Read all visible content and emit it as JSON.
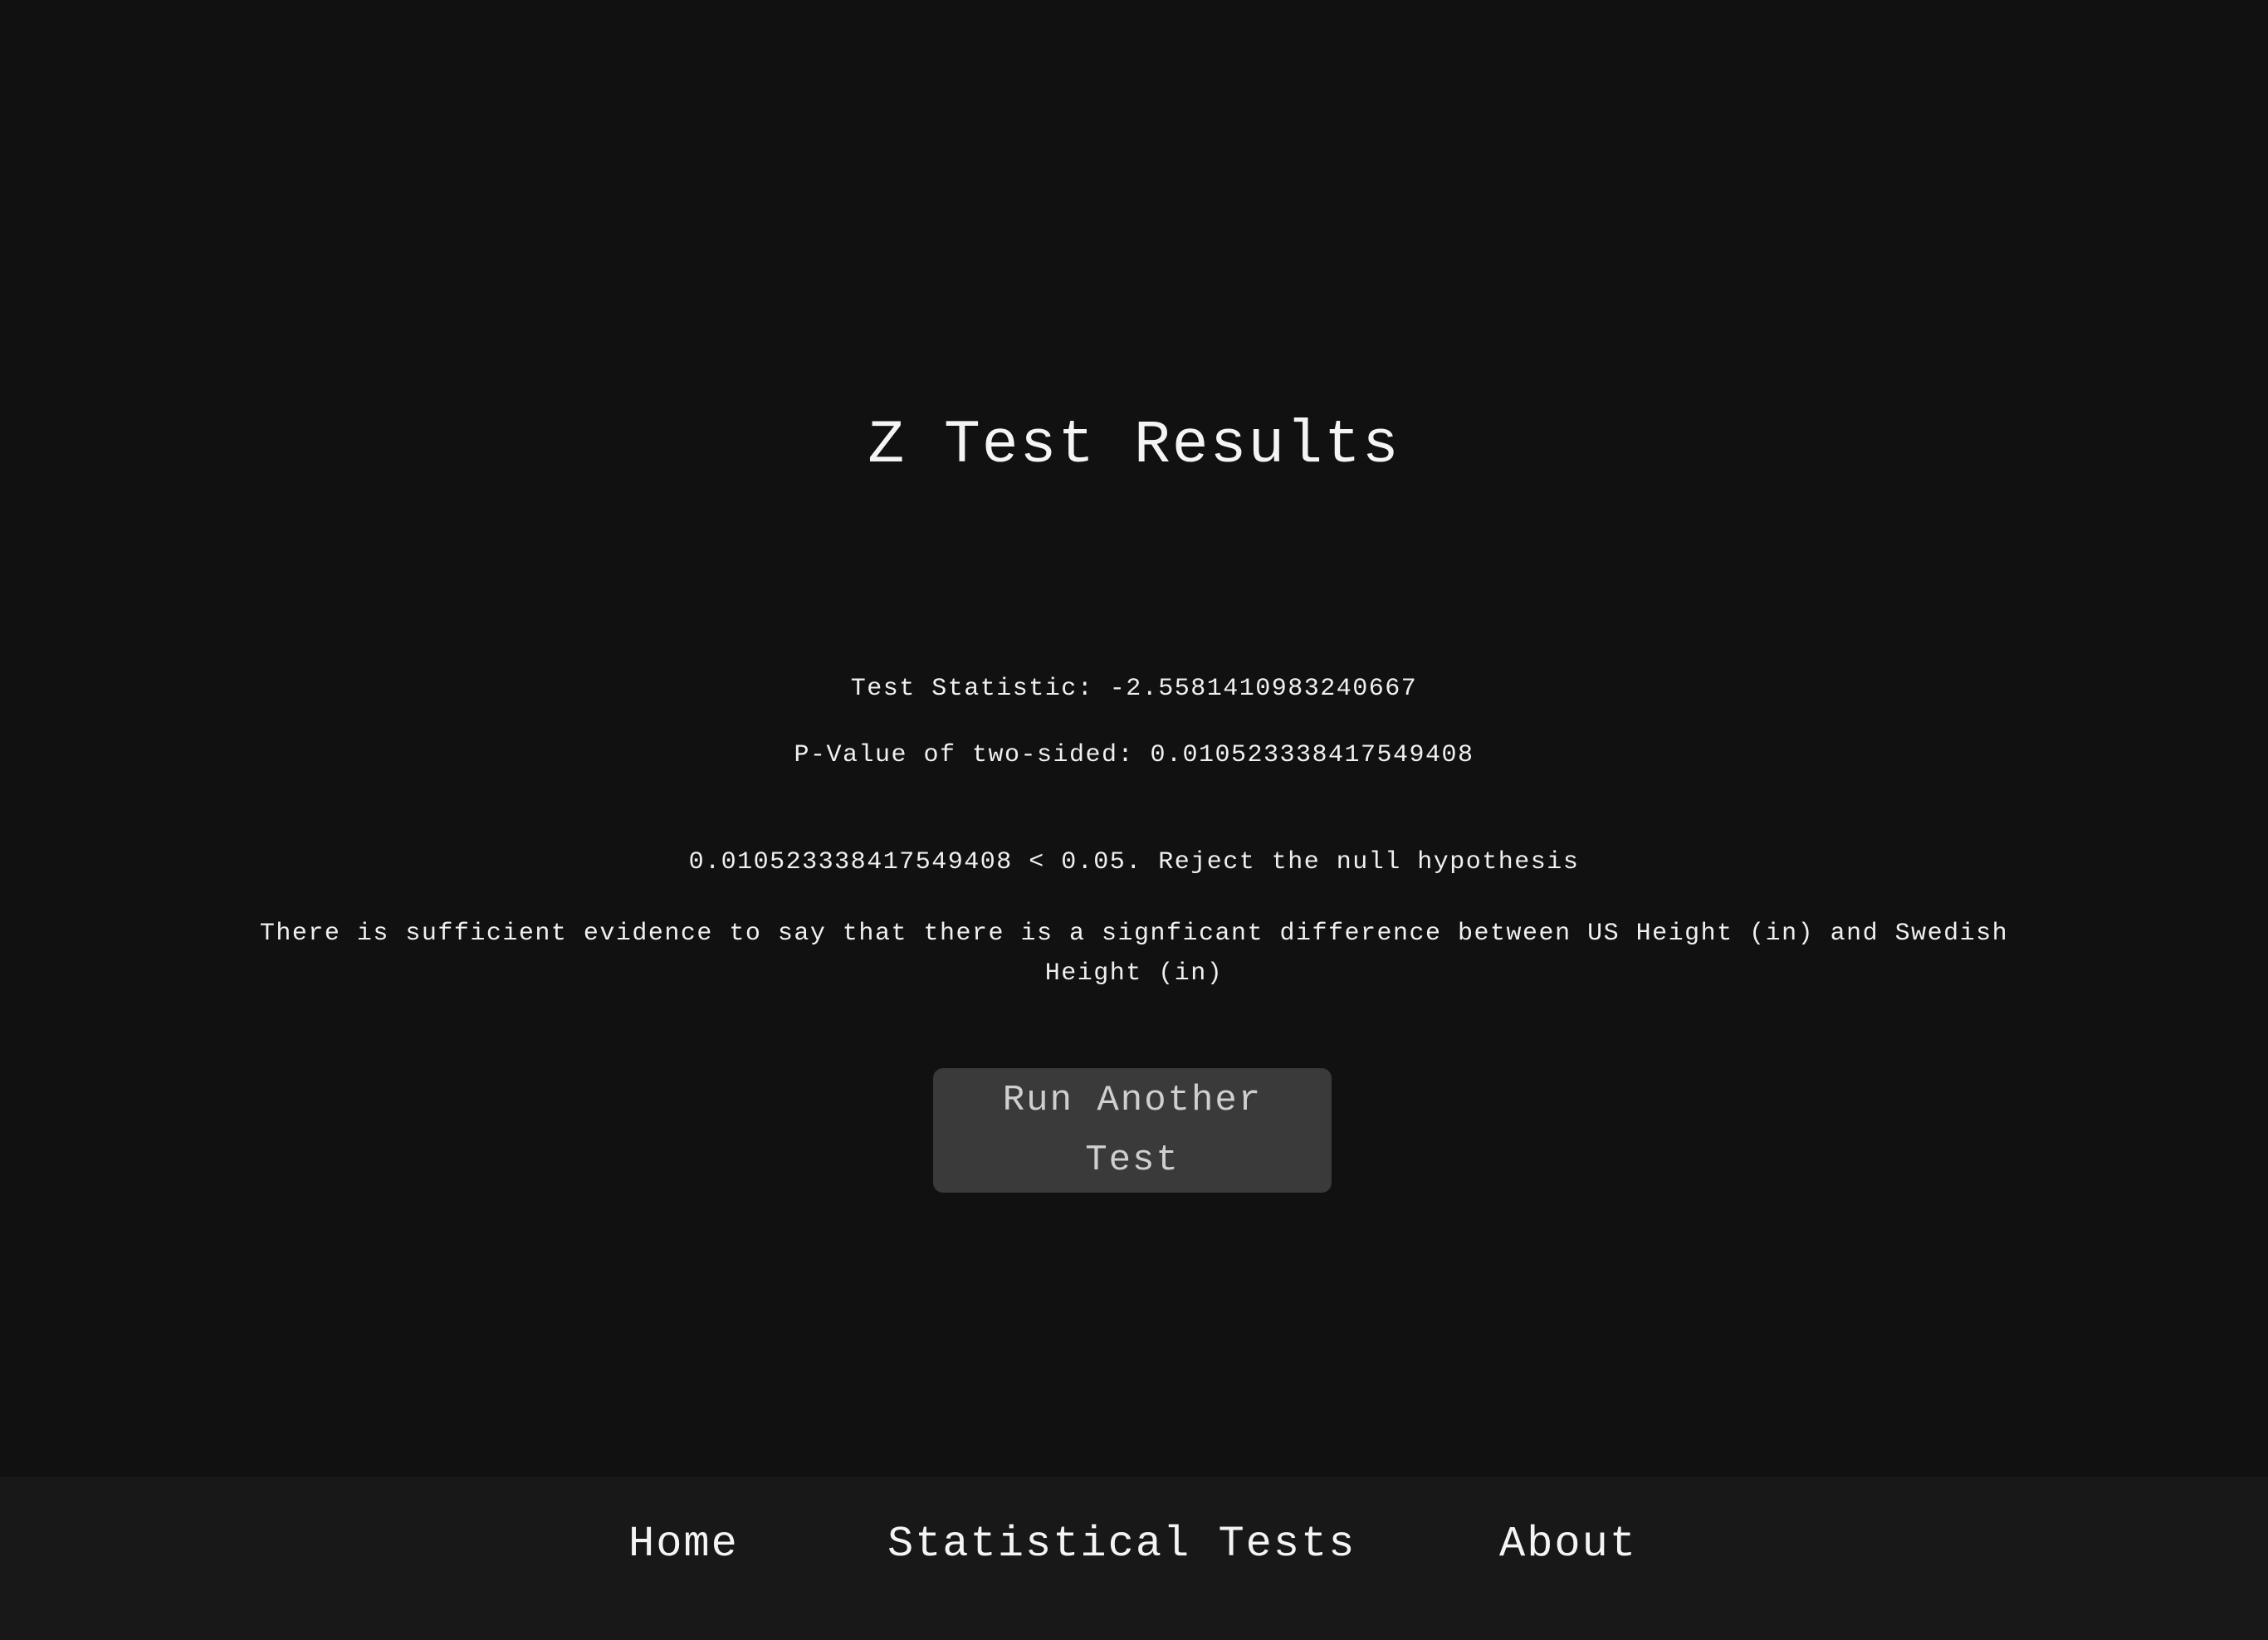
{
  "main": {
    "title": "Z Test Results",
    "test_statistic": "Test Statistic: -2.5581410983240667",
    "p_value": "P-Value of two-sided: 0.010523338417549408",
    "comparison": "0.010523338417549408 < 0.05. Reject the null hypothesis",
    "conclusion": "There is sufficient evidence to say that there is a signficant difference between US Height (in) and Swedish Height (in)",
    "run_another_label": "Run Another Test"
  },
  "nav": {
    "items": [
      {
        "label": "Home"
      },
      {
        "label": "Statistical Tests"
      },
      {
        "label": "About"
      }
    ]
  },
  "colors": {
    "background": "#111111",
    "navbar_background": "#181818",
    "button_background": "#3a3a3a",
    "text": "#f2f2f2",
    "button_text": "#cfcfcf"
  }
}
